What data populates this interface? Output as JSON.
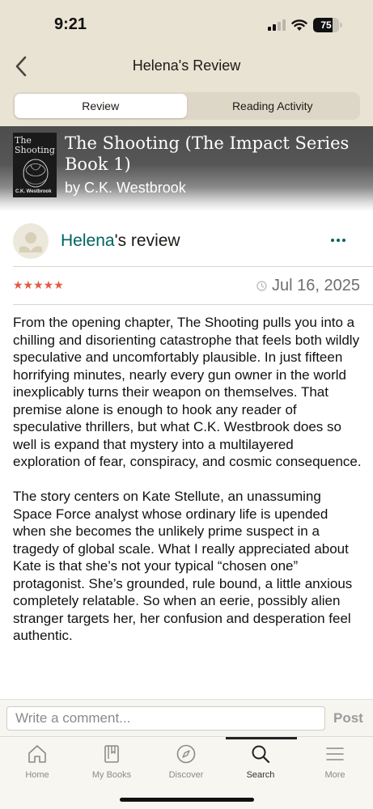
{
  "status_bar": {
    "time": "9:21",
    "battery": "75",
    "battery_level": 0.75
  },
  "header": {
    "title": "Helena's Review",
    "back_icon": "chevron-left-icon"
  },
  "tabs": [
    {
      "label": "Review",
      "active": true
    },
    {
      "label": "Reading Activity",
      "active": false
    }
  ],
  "book": {
    "title": "The Shooting (The Impact Series Book 1)",
    "author": "by C.K. Westbrook",
    "cover": {
      "title": "The Shooting",
      "author": "C.K. Westbrook"
    }
  },
  "review": {
    "reviewer": "Helena",
    "reviewer_suffix": "'s review",
    "rating": 5,
    "stars": "★★★★★",
    "date": "Jul 16, 2025",
    "paragraphs": [
      "From the opening chapter, The Shooting pulls you into a chilling and disorienting catastrophe that feels both wildly speculative and uncomfortably plausible. In just fifteen horrifying minutes, nearly every gun owner in the world inexplicably turns their weapon on themselves. That premise alone is enough to hook any reader of speculative thrillers, but what C.K. Westbrook does so well is expand that mystery into a multilayered exploration of fear, conspiracy, and cosmic consequence.",
      "The story centers on Kate Stellute, an unassuming Space Force analyst whose ordinary life is upended when she becomes the unlikely prime suspect in a tragedy of global scale. What I really appreciated about Kate is that she’s not your typical “chosen one” protagonist. She’s grounded, rule bound, a little anxious completely relatable. So when an eerie, possibly alien stranger targets her, her confusion and desperation feel authentic."
    ]
  },
  "comment": {
    "placeholder": "Write a comment...",
    "post_label": "Post"
  },
  "tab_bar": [
    {
      "label": "Home",
      "icon": "home-icon"
    },
    {
      "label": "My Books",
      "icon": "my-books-icon"
    },
    {
      "label": "Discover",
      "icon": "compass-icon"
    },
    {
      "label": "Search",
      "icon": "search-icon",
      "active": true
    },
    {
      "label": "More",
      "icon": "menu-icon"
    }
  ],
  "colors": {
    "header_bg": "#e9e3d4",
    "accent_green": "#00635d",
    "star_color": "#e25b45"
  }
}
